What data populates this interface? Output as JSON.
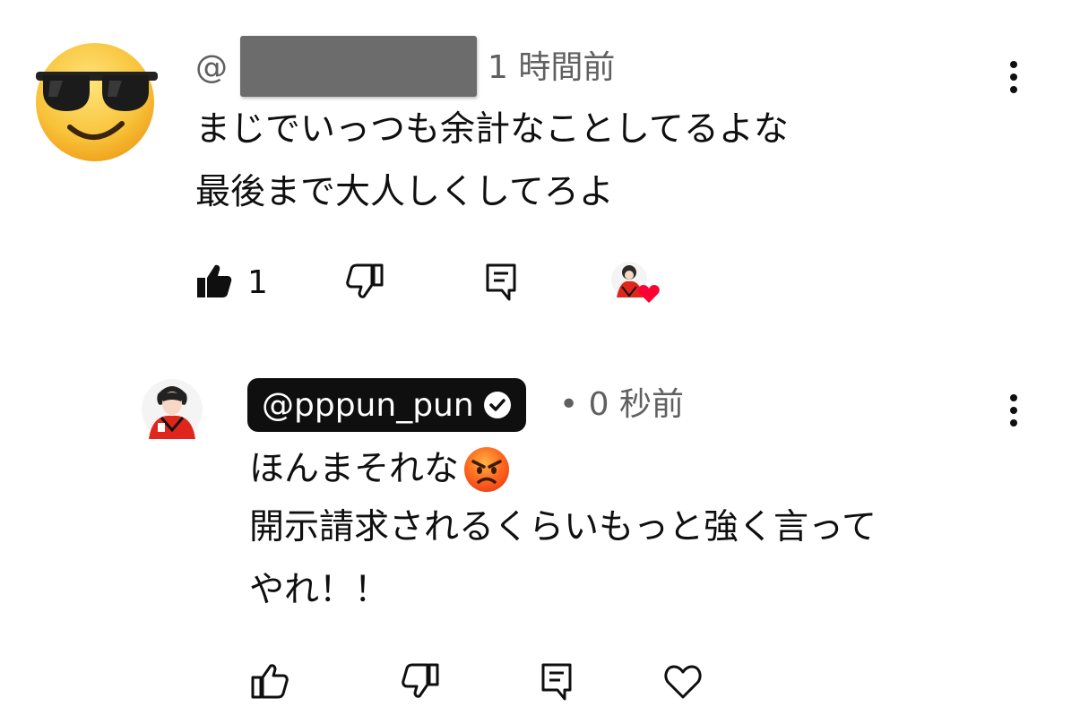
{
  "comment": {
    "handle_prefix": "@",
    "time": "1 時間前",
    "line1": "まじでいっつも余計なことしてるよな",
    "line2": "最後まで大人しくしてろよ",
    "like_count": "1",
    "avatar": "smiling-face-with-sunglasses"
  },
  "reply": {
    "handle": "@pppun_pun",
    "verified_icon": "check-circle-icon",
    "time": "• 0 秒前",
    "line1": "ほんまそれな",
    "line1_emoji": "angry-face",
    "line2": "開示請求されるくらいもっと強く言って",
    "line3": "やれ！！"
  },
  "colors": {
    "text": "#0f0f0f",
    "secondary": "#606060",
    "heart": "#ff0033",
    "redaction": "#6c6c6c"
  }
}
